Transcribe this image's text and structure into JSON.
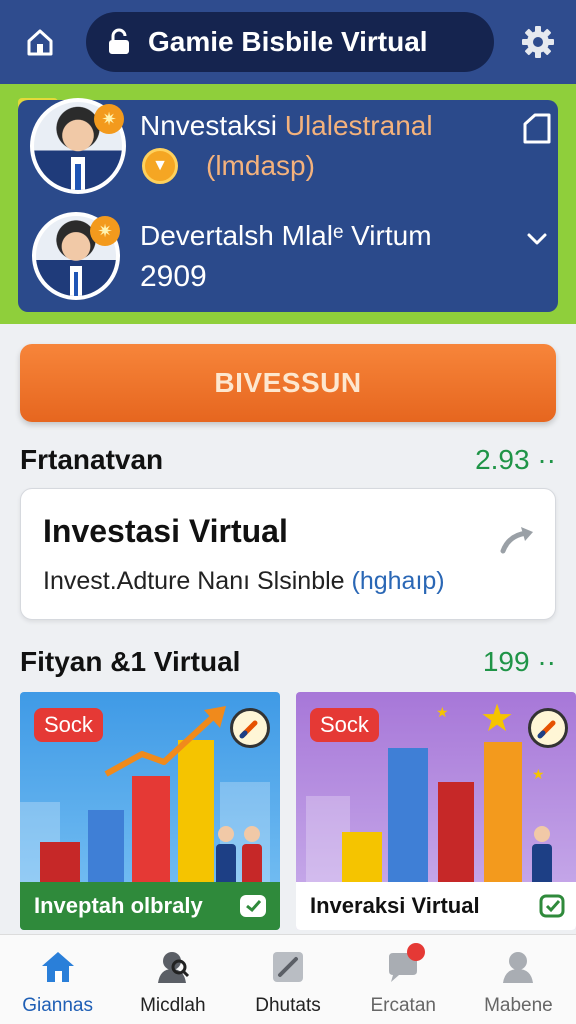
{
  "header": {
    "title": "Gamie Bisbile Virtual",
    "icons": {
      "left": "home-icon",
      "title": "lock-icon",
      "right": "gear-icon"
    }
  },
  "profile": {
    "row1": {
      "title_part1": "Nnvestaksi",
      "title_part2": "Ulalestranal",
      "subtitle": "(lmdasp)"
    },
    "row2": {
      "title": "Devertalsh Mlalᵉ Virtum",
      "value": "2909"
    }
  },
  "cta": {
    "label": "BIVESSUN"
  },
  "section1": {
    "heading": "Frtanatvan",
    "value": "2.93 ··"
  },
  "invest_card": {
    "title": "Investasi Virtual",
    "description": "Invest.Adture Nanı Slsinble",
    "highlight": "(hghaıp)"
  },
  "section2": {
    "heading": "Fityan &1 Virtual",
    "value": "199 ··"
  },
  "tiles": [
    {
      "tag": "Sock",
      "label": "Inveptah olbraly"
    },
    {
      "tag": "Sock",
      "label": "Inveraksi Virtual"
    }
  ],
  "nav": {
    "items": [
      {
        "label": "Giannas",
        "icon": "home-icon"
      },
      {
        "label": "Micdlah",
        "icon": "user-icon"
      },
      {
        "label": "Dhutats",
        "icon": "edit-icon"
      },
      {
        "label": "Ercatan",
        "icon": "chat-icon"
      },
      {
        "label": "Mabene",
        "icon": "profile-icon"
      }
    ]
  },
  "colors": {
    "header_bg": "#2f4c8e",
    "accent_green": "#8fcf3b",
    "cta_orange": "#f07a2e",
    "value_green": "#1f9447",
    "nav_active": "#1f5fb5"
  }
}
